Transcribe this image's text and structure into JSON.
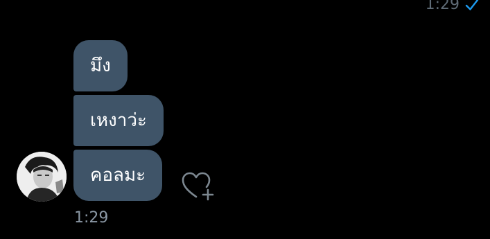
{
  "previous_message": {
    "time": "1:29",
    "status_icon": "read-check-icon"
  },
  "messages": [
    {
      "text": "มึง"
    },
    {
      "text": "เหงาว่ะ"
    },
    {
      "text": "คอลมะ"
    }
  ],
  "sender": {
    "avatar_icon": "profile-avatar"
  },
  "reaction": {
    "icon": "heart-add-icon"
  },
  "message_time": "1:29",
  "colors": {
    "background": "#000000",
    "bubble": "#3f5468",
    "bubble_text": "#ffffff",
    "timestamp": "#8b98a5",
    "check": "#1d9bf0"
  }
}
